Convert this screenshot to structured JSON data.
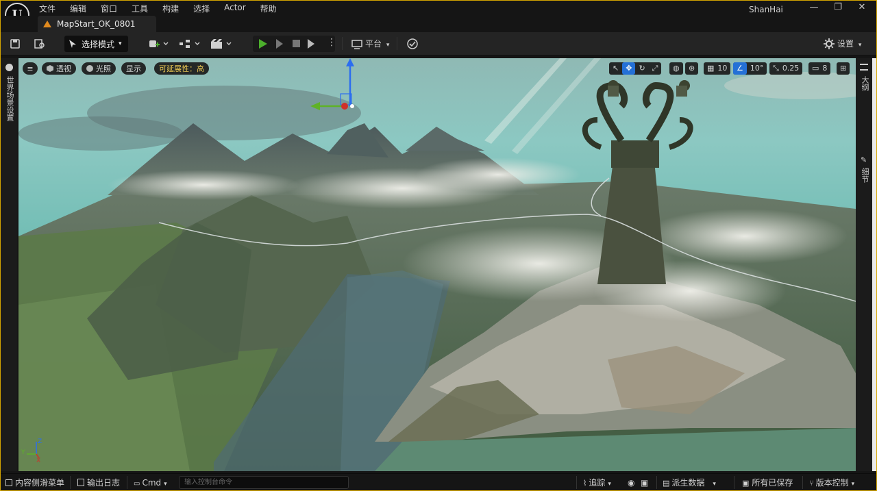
{
  "menubar": {
    "logo": "U",
    "items": [
      "文件",
      "编辑",
      "窗口",
      "工具",
      "构建",
      "选择",
      "Actor",
      "帮助"
    ],
    "username": "ShanHai",
    "window_buttons": [
      "—",
      "❐",
      "✕"
    ]
  },
  "tab": {
    "label": "MapStart_OK_0801"
  },
  "toolbar": {
    "mode_label": "选择模式",
    "platform_label": "平台",
    "settings_label": "设置"
  },
  "viewport": {
    "left_pills": [
      "透视",
      "光照",
      "显示"
    ],
    "scalability": "可延展性：高",
    "grid_snap": "10",
    "rotation_snap": "10°",
    "scale_snap": "0.25",
    "camera_speed": "8"
  },
  "left_panel": {
    "label": "世界场景设置"
  },
  "right_panel": {
    "outline_label": "大纲",
    "details_label": "细节"
  },
  "statusbar": {
    "content_drawer": "内容侧滑菜单",
    "output_log": "输出日志",
    "cmd": "Cmd",
    "console_placeholder": "输入控制台命令",
    "trace": "追踪",
    "derived_data": "派生数据",
    "all_saved": "所有已保存",
    "source_control": "版本控制"
  },
  "colors": {
    "accent_border": "#d4a500",
    "play_green": "#4caf2c",
    "snap_active": "#1c6ad9",
    "scalability_text": "#f2c84b"
  }
}
